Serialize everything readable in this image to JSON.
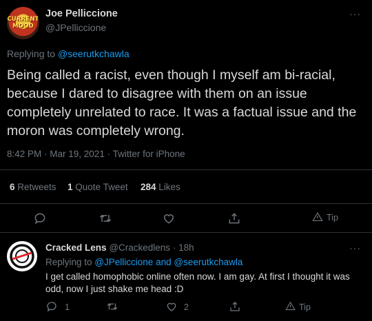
{
  "main_tweet": {
    "name": "Joe Pelliccione",
    "handle": "@JPelliccione",
    "avatar_text": "CURRENT MOOD",
    "replying_prefix": "Replying to",
    "replying_to": "@seerutkchawla",
    "text": "Being called a racist, even though I myself am bi-racial, because I dared to disagree with them on an issue completely unrelated to race. It was a factual issue and the moron was completely wrong.",
    "timestamp": "8:42 PM · Mar 19, 2021 · Twitter for iPhone",
    "stats": {
      "retweets_count": "6",
      "retweets_label": "Retweets",
      "quotes_count": "1",
      "quotes_label": "Quote Tweet",
      "likes_count": "284",
      "likes_label": "Likes"
    },
    "tip_label": "Tip",
    "more_label": "···"
  },
  "reply_tweet": {
    "name": "Cracked Lens",
    "handle": "@Crackedlens",
    "separator": "·",
    "time": "18h",
    "replying_prefix": "Replying to",
    "replying_to_1": "@JPelliccione",
    "and_word": "and",
    "replying_to_2": "@seerutkchawla",
    "text": "I get called homophobic online often now.  I am gay.  At first I thought it was odd, now I just shake me head :D",
    "reply_count": "1",
    "like_count": "2",
    "tip_label": "Tip",
    "more_label": "···"
  },
  "colors": {
    "background": "#000000",
    "text": "#d9d9d9",
    "muted": "#6e767d",
    "link": "#1d9bf0",
    "border": "#2f3336"
  }
}
